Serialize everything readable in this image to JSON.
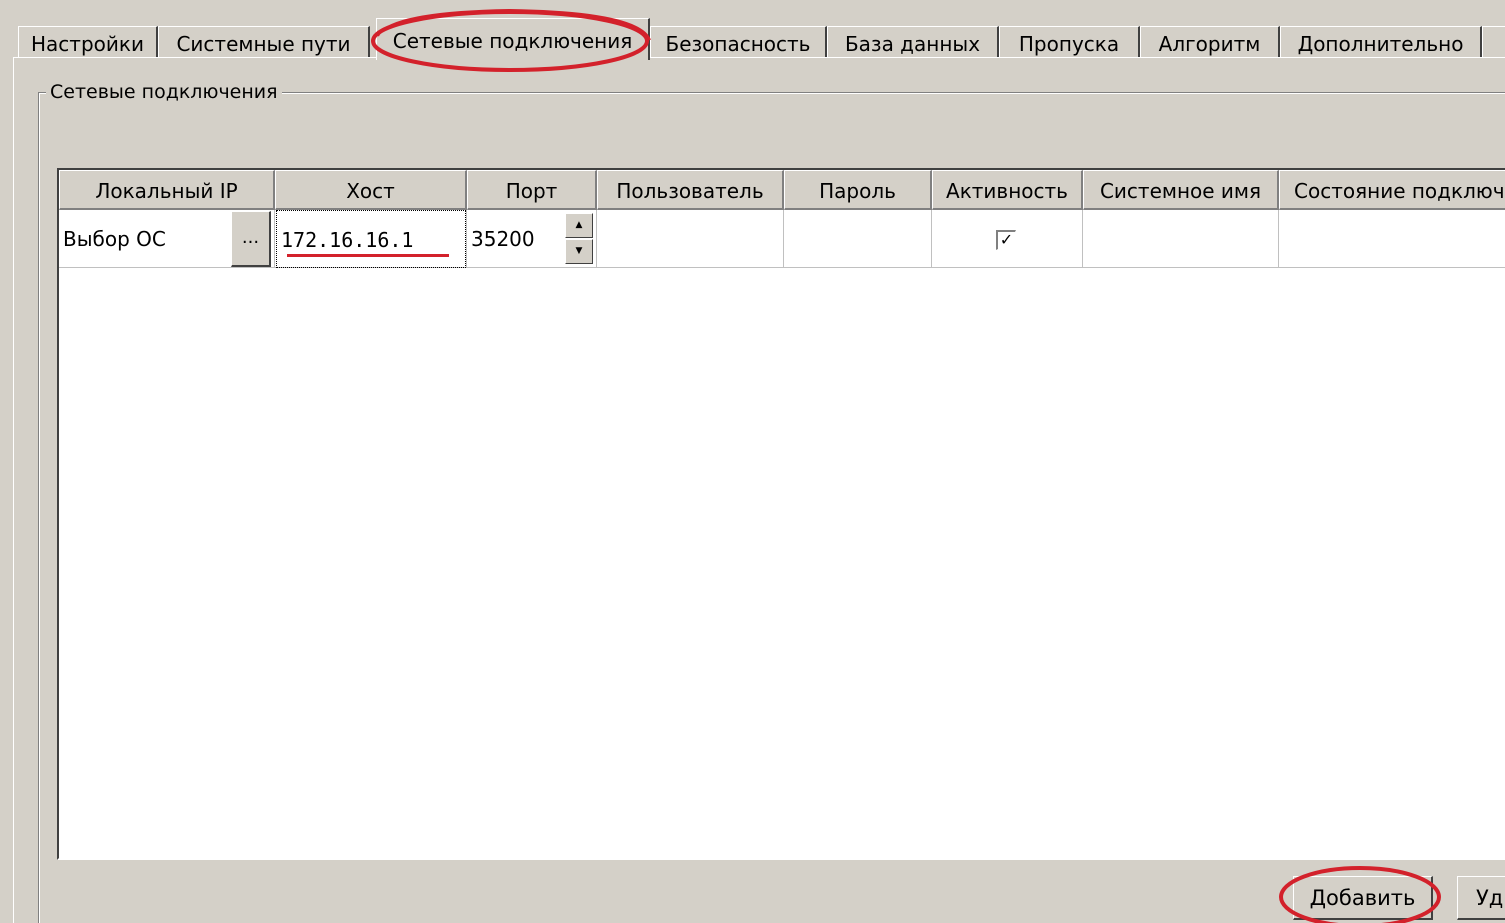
{
  "tabs": [
    {
      "label": "Настройки"
    },
    {
      "label": "Системные пути"
    },
    {
      "label": "Сетевые подключения",
      "active": true
    },
    {
      "label": "Безопасность"
    },
    {
      "label": "База данных"
    },
    {
      "label": "Пропуска"
    },
    {
      "label": "Алгоритм"
    },
    {
      "label": "Дополнительно"
    }
  ],
  "group": {
    "title": "Сетевые подключения"
  },
  "grid": {
    "columns": [
      "Локальный IP",
      "Хост",
      "Порт",
      "Пользователь",
      "Пароль",
      "Активность",
      "Системное имя",
      "Состояние подключе"
    ],
    "rows": [
      {
        "local_ip": "Выбор ОС",
        "ellipsis": "...",
        "host": "172.16.16.1",
        "port": "35200",
        "user": "",
        "password": "",
        "active_mark": "✓",
        "system_name": "",
        "state": ""
      }
    ]
  },
  "buttons": {
    "add": "Добавить",
    "delete_partial": "Уд"
  },
  "colors": {
    "annotation": "#d3212b",
    "window_bg": "#d4d0c8"
  },
  "icons": {
    "spin_up": "spin-up-arrow-icon",
    "spin_down": "spin-down-arrow-icon",
    "check": "checkmark-icon"
  }
}
